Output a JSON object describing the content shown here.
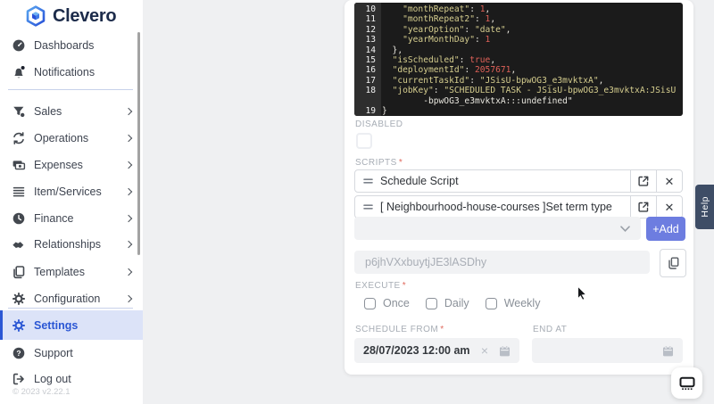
{
  "required_mark": "*",
  "brand": {
    "name": "Clevero"
  },
  "sidebar": {
    "items": [
      {
        "label": "Dashboards",
        "icon": "gauge-icon",
        "chevron": false
      },
      {
        "label": "Notifications",
        "icon": "bell-icon",
        "chevron": false
      },
      {
        "label": "Sales",
        "icon": "funnel-icon",
        "chevron": true
      },
      {
        "label": "Operations",
        "icon": "sync-icon",
        "chevron": true
      },
      {
        "label": "Expenses",
        "icon": "banknotes-icon",
        "chevron": true
      },
      {
        "label": "Item/Services",
        "icon": "list-icon",
        "chevron": true
      },
      {
        "label": "Finance",
        "icon": "clock-icon",
        "chevron": true
      },
      {
        "label": "Relationships",
        "icon": "handshake-icon",
        "chevron": true
      },
      {
        "label": "Templates",
        "icon": "pages-icon",
        "chevron": true
      },
      {
        "label": "Configuration",
        "icon": "gear-icon",
        "chevron": true
      },
      {
        "label": "Settings",
        "icon": "gear-icon",
        "chevron": false,
        "active": true
      },
      {
        "label": "Support",
        "icon": "question-icon",
        "chevron": false
      },
      {
        "label": "Log out",
        "icon": "logout-icon",
        "chevron": false
      }
    ],
    "footer": "© 2023 v2.22.1",
    "active_color": "#2b57d4"
  },
  "code_editor": {
    "lines": [
      {
        "n": "10",
        "t": "    \"monthRepeat\": 1,"
      },
      {
        "n": "11",
        "t": "    \"monthRepeat2\": 1,"
      },
      {
        "n": "12",
        "t": "    \"yearOption\": \"date\","
      },
      {
        "n": "13",
        "t": "    \"yearMonthDay\": 1"
      },
      {
        "n": "14",
        "t": "  },"
      },
      {
        "n": "15",
        "t": "  \"isScheduled\": true,"
      },
      {
        "n": "16",
        "t": "  \"deploymentId\": 2057671,"
      },
      {
        "n": "17",
        "t": "  \"currentTaskId\": \"JSisU-bpwOG3_e3mvktxA\","
      },
      {
        "n": "18",
        "t": "  \"jobKey\": \"SCHEDULED TASK - JSisU-bpwOG3_e3mvktxA:JSisU"
      },
      {
        "n": "",
        "t": "        -bpwOG3_e3mvktxA:::undefined\"",
        "c": "k"
      },
      {
        "n": "19",
        "t": "}"
      }
    ],
    "colors": {
      "background": "#1b1b1b",
      "gutter": "#2e2e2e",
      "string": "#d5cd8e",
      "number": "#df6158",
      "plain": "#e9e7df"
    }
  },
  "form": {
    "disabled": {
      "label": "DISABLED",
      "checked": false
    },
    "scripts": {
      "label": "SCRIPTS",
      "required": true,
      "rows": [
        {
          "title": "Schedule Script"
        },
        {
          "title": "[ Neighbourhood-house-courses ]Set term type"
        }
      ],
      "add_button": "+Add",
      "dropdown_value": ""
    },
    "token": {
      "value": "p6jhVXxbuytjJE3lASDhy"
    },
    "execute": {
      "label": "EXECUTE",
      "required": true,
      "options": [
        {
          "label": "Once",
          "checked": false
        },
        {
          "label": "Daily",
          "checked": false
        },
        {
          "label": "Weekly",
          "checked": false
        }
      ]
    },
    "schedule_from": {
      "label": "SCHEDULE FROM",
      "required": true,
      "value": "28/07/2023 12:00 am"
    },
    "end_at": {
      "label": "END AT",
      "value": ""
    }
  },
  "help_tab": {
    "label": "Help",
    "color": "#3e4d66"
  },
  "accent_color": "#6d7de0"
}
